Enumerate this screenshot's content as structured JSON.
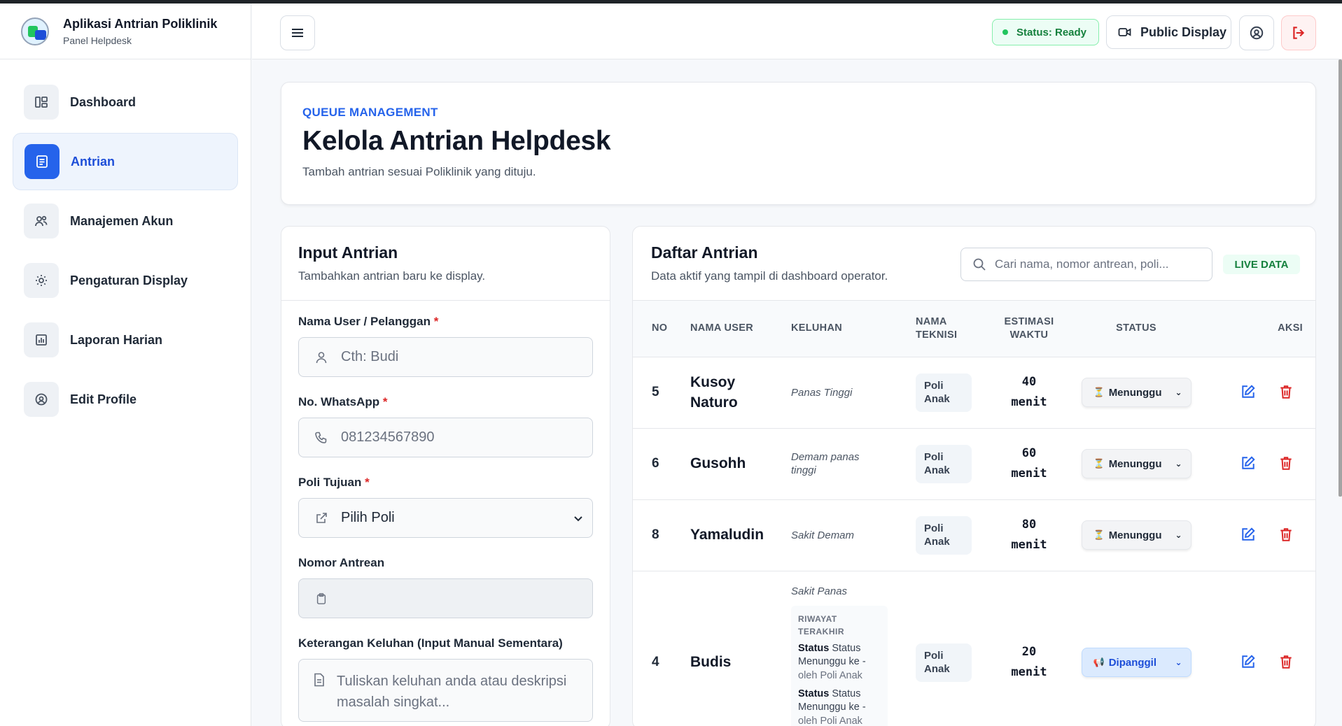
{
  "app": {
    "title": "Aplikasi Antrian Poliklinik",
    "subtitle": "Panel Helpdesk"
  },
  "sidebar": {
    "items": [
      {
        "label": "Dashboard",
        "icon": "dashboard-icon",
        "active": false
      },
      {
        "label": "Antrian",
        "icon": "list-icon",
        "active": true
      },
      {
        "label": "Manajemen Akun",
        "icon": "users-icon",
        "active": false
      },
      {
        "label": "Pengaturan Display",
        "icon": "sun-icon",
        "active": false
      },
      {
        "label": "Laporan Harian",
        "icon": "chart-icon",
        "active": false
      },
      {
        "label": "Edit Profile",
        "icon": "user-circle-icon",
        "active": false
      }
    ]
  },
  "header": {
    "status_label": "Status: Ready",
    "public_display_label": "Public Display"
  },
  "page": {
    "eyebrow": "QUEUE MANAGEMENT",
    "title": "Kelola Antrian Helpdesk",
    "subtitle": "Tambah antrian sesuai Poliklinik yang dituju."
  },
  "input_form": {
    "title": "Input Antrian",
    "subtitle": "Tambahkan antrian baru ke display.",
    "name_label": "Nama User / Pelanggan",
    "name_placeholder": "Cth: Budi",
    "phone_label": "No. WhatsApp",
    "phone_placeholder": "081234567890",
    "poli_label": "Poli Tujuan",
    "poli_selected": "Pilih Poli",
    "nomor_label": "Nomor Antrean",
    "nomor_value": "",
    "keluhan_label": "Keterangan Keluhan (Input Manual Sementara)",
    "keluhan_placeholder": "Tuliskan keluhan anda atau deskripsi masalah singkat..."
  },
  "queue_list": {
    "title": "Daftar Antrian",
    "subtitle": "Data aktif yang tampil di dashboard operator.",
    "search_placeholder": "Cari nama, nomor antrean, poli...",
    "live_badge": "LIVE DATA",
    "columns": [
      "NO",
      "NAMA USER",
      "KELUHAN",
      "NAMA TEKNISI",
      "ESTIMASI WAKTU",
      "STATUS",
      "AKSI"
    ],
    "rows": [
      {
        "no": "5",
        "name": "Kusoy Naturo",
        "keluhan": "Panas Tinggi",
        "teknisi": "Poli Anak",
        "estimasi": "40 menit",
        "status": "Menunggu"
      },
      {
        "no": "6",
        "name": "Gusohh",
        "keluhan": "Demam panas tinggi",
        "teknisi": "Poli Anak",
        "estimasi": "60 menit",
        "status": "Menunggu"
      },
      {
        "no": "8",
        "name": "Yamaludin",
        "keluhan": "Sakit Demam",
        "teknisi": "Poli Anak",
        "estimasi": "80 menit",
        "status": "Menunggu"
      },
      {
        "no": "4",
        "name": "Budis",
        "keluhan": "Sakit Panas",
        "teknisi": "Poli Anak",
        "estimasi": "20 menit",
        "status": "Dipanggil",
        "history_title": "RIWAYAT TERAKHIR",
        "history": [
          {
            "label": "Status",
            "text": "Status Menunggu ke -",
            "by": "oleh Poli Anak"
          },
          {
            "label": "Status",
            "text": "Status Menunggu ke -",
            "by": "oleh Poli Anak"
          }
        ]
      }
    ]
  },
  "colors": {
    "accent": "#2563eb",
    "success": "#15803d",
    "danger": "#dc2626"
  }
}
